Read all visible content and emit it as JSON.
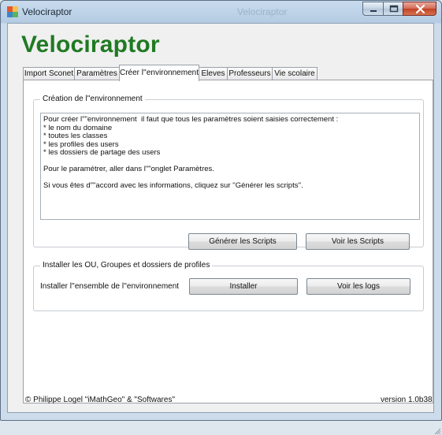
{
  "window": {
    "title": "Velociraptor",
    "title_ghost": "Velociraptor"
  },
  "app": {
    "brand": "Velociraptor",
    "brand_color": "#207a23"
  },
  "tabs": [
    {
      "label": "Import Sconet",
      "active": false
    },
    {
      "label": "Paramètres",
      "active": false
    },
    {
      "label": "Créer l''environnement",
      "active": true
    },
    {
      "label": "Eleves",
      "active": false
    },
    {
      "label": "Professeurs",
      "active": false
    },
    {
      "label": "Vie scolaire",
      "active": false
    }
  ],
  "creation_group": {
    "legend": "Création de l''environnement",
    "text_lines": [
      "Pour créer l\"\"environnement  il faut que tous les paramètres soient saisies correctement :",
      "* le nom du domaine",
      "* toutes les classes",
      "* les profiles des users",
      "* les dossiers de partage des users",
      "",
      "Pour le paramétrer, aller dans l\"\"onglet Paramètres.",
      "",
      "Si vous êtes d\"\"accord avec les informations, cliquez sur ''Générer les scripts''."
    ],
    "generate_button": "Générer les Scripts",
    "view_button": "Voir les Scripts"
  },
  "install_group": {
    "legend": "Installer les OU, Groupes et dossiers de profiles",
    "label": "Installer l''ensemble de l''environnement",
    "install_button": "Installer",
    "logs_button": "Voir les logs"
  },
  "footer": {
    "copyright": "© Philippe Logel \"iMathGeo\" & \"Softwares\"",
    "version": "version  1.0b38"
  }
}
